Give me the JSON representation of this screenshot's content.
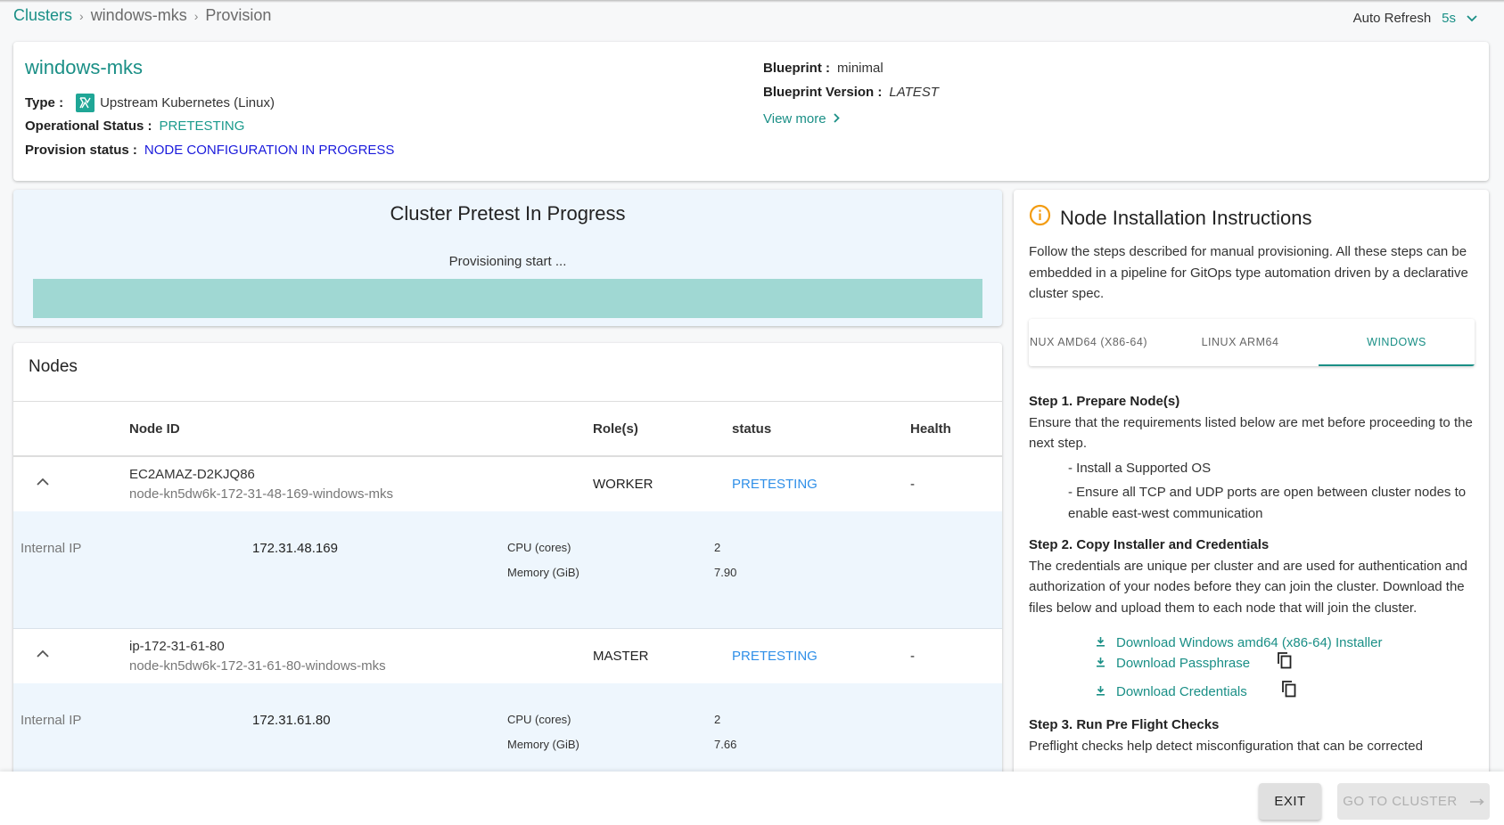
{
  "breadcrumb": {
    "items": [
      "Clusters",
      "windows-mks",
      "Provision"
    ],
    "separator": "›"
  },
  "auto_refresh": {
    "label": "Auto Refresh",
    "value": "5s"
  },
  "summary": {
    "cluster_name": "windows-mks",
    "type_label": "Type :",
    "type_value": "Upstream Kubernetes (Linux)",
    "op_status_label": "Operational Status :",
    "op_status_value": "PRETESTING",
    "prov_status_label": "Provision status :",
    "prov_status_value": "NODE CONFIGURATION IN PROGRESS",
    "blueprint_label": "Blueprint :",
    "blueprint_value": "minimal",
    "blueprint_version_label": "Blueprint Version :",
    "blueprint_version_value": "LATEST",
    "view_more": "View more"
  },
  "pretest": {
    "title": "Cluster Pretest In Progress",
    "subtitle": "Provisioning start ...",
    "progress_percent": 100
  },
  "nodes": {
    "title": "Nodes",
    "columns": [
      "Node ID",
      "Role(s)",
      "status",
      "Health"
    ],
    "detail_labels": {
      "internal_ip": "Internal IP",
      "cpu": "CPU (cores)",
      "memory": "Memory (GiB)"
    },
    "rows": [
      {
        "hostname": "EC2AMAZ-D2KJQ86",
        "node_id": "node-kn5dw6k-172-31-48-169-windows-mks",
        "role": "WORKER",
        "status": "PRETESTING",
        "health": "-",
        "internal_ip": "172.31.48.169",
        "cpu": "2",
        "memory": "7.90"
      },
      {
        "hostname": "ip-172-31-61-80",
        "node_id": "node-kn5dw6k-172-31-61-80-windows-mks",
        "role": "MASTER",
        "status": "PRETESTING",
        "health": "-",
        "internal_ip": "172.31.61.80",
        "cpu": "2",
        "memory": "7.66"
      }
    ]
  },
  "instructions": {
    "title": "Node Installation Instructions",
    "intro": "Follow the steps described for manual provisioning. All these steps can be embedded in a pipeline for GitOps type automation driven by a declarative cluster spec.",
    "tabs": [
      "NUX AMD64 (X86-64)",
      "LINUX ARM64",
      "WINDOWS"
    ],
    "active_tab": "WINDOWS",
    "step1_title": "Step 1. Prepare Node(s)",
    "step1_text": "Ensure that the requirements listed below are met before proceeding to the next step.",
    "step1_bullets": [
      "- Install a Supported OS",
      "- Ensure all TCP and UDP ports are open between cluster nodes to enable east-west communication"
    ],
    "step2_title": "Step 2. Copy Installer and Credentials",
    "step2_text": "The credentials are unique per cluster and are used for authentication and authorization of your nodes before they can join the cluster. Download the files below and upload them to each node that will join the cluster.",
    "downloads": [
      "Download Windows amd64 (x86-64) Installer",
      "Download Passphrase",
      "Download Credentials"
    ],
    "step3_title": "Step 3. Run Pre Flight Checks",
    "step3_text": "Preflight checks help detect misconfiguration that can be corrected"
  },
  "footer": {
    "exit": "EXIT",
    "go_to_cluster": "GO TO CLUSTER"
  },
  "colors": {
    "accent": "#1a8f86",
    "status_blue": "#2f8fe8",
    "provision_blue": "#1b1bdc",
    "warning": "#f39c12",
    "progress": "#a0d8d3"
  }
}
